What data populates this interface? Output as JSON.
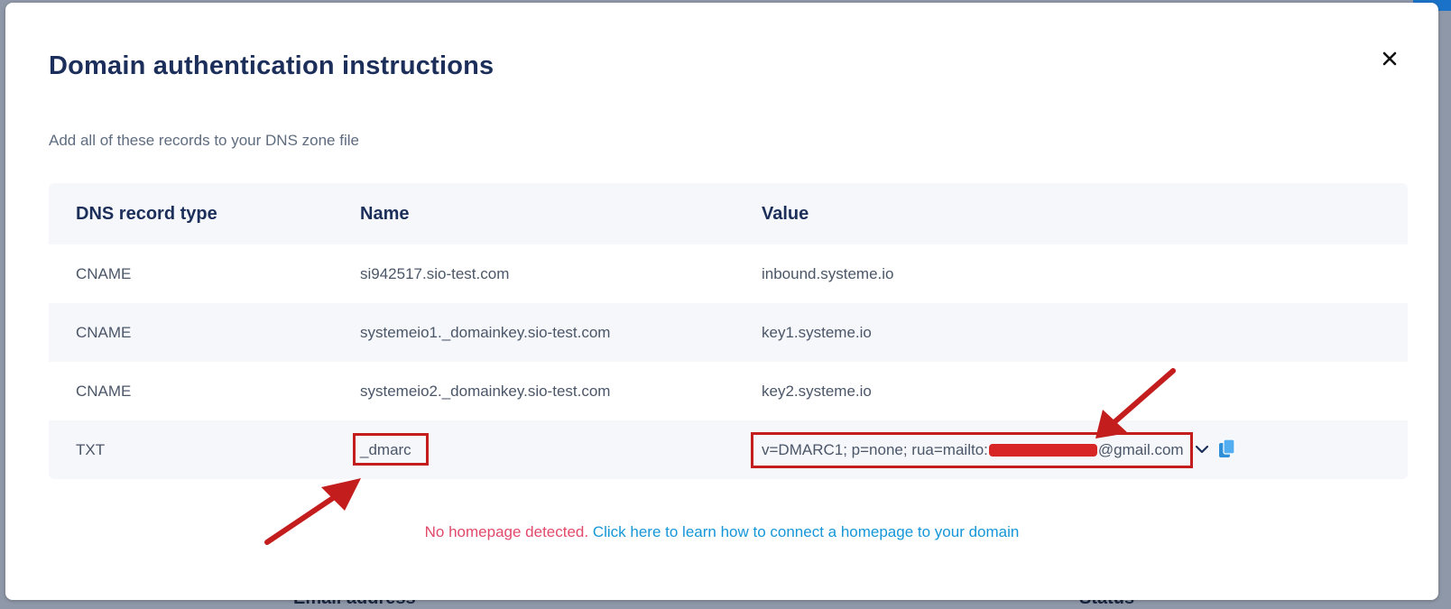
{
  "modal": {
    "title": "Domain authentication instructions",
    "subtitle": "Add all of these records to your DNS zone file",
    "close_icon": "close-icon"
  },
  "table": {
    "headers": [
      "DNS record type",
      "Name",
      "Value"
    ],
    "rows": [
      {
        "type": "CNAME",
        "name": "si942517.sio-test.com",
        "value": "inbound.systeme.io"
      },
      {
        "type": "CNAME",
        "name": "systemeio1._domainkey.sio-test.com",
        "value": "key1.systeme.io"
      },
      {
        "type": "CNAME",
        "name": "systemeio2._domainkey.sio-test.com",
        "value": "key2.systeme.io"
      },
      {
        "type": "TXT",
        "name": "_dmarc",
        "value_prefix": "v=DMARC1; p=none; rua=mailto:",
        "value_suffix": "@gmail.com"
      }
    ],
    "copy_icon": "copy-icon",
    "expand_icon": "chevron-down-icon"
  },
  "footer": {
    "warning": "No homepage detected.",
    "link": "Click here to learn how to connect a homepage to your domain"
  },
  "background": {
    "partial_headers": [
      "Email address",
      "Status"
    ]
  },
  "colors": {
    "title": "#1c2e5a",
    "annotation_red": "#c41d1d",
    "warning": "#e2496a",
    "link": "#1596d8"
  }
}
